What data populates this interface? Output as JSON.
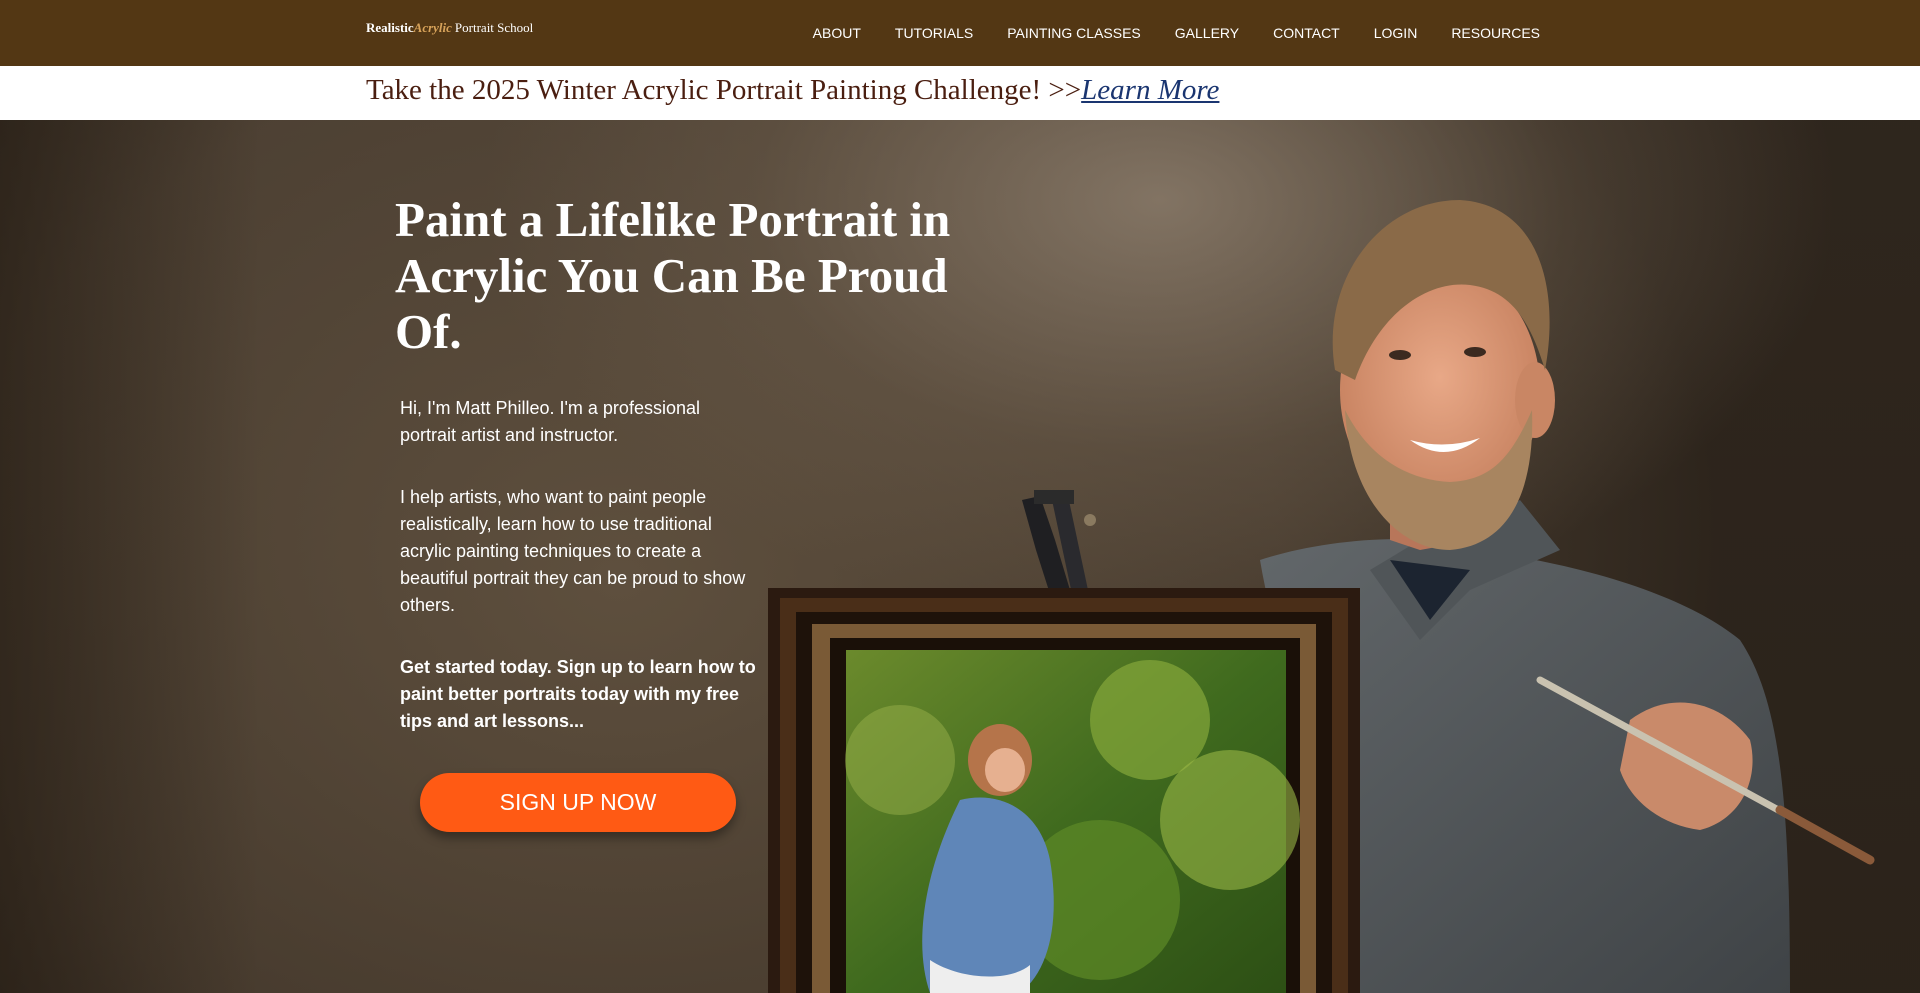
{
  "header": {
    "logo": {
      "part1": "Realistic",
      "part2": "Acrylic",
      "part3": "Portrait School"
    },
    "nav": [
      {
        "label": "ABOUT"
      },
      {
        "label": "TUTORIALS"
      },
      {
        "label": "PAINTING CLASSES"
      },
      {
        "label": "GALLERY"
      },
      {
        "label": "CONTACT"
      },
      {
        "label": "LOGIN"
      },
      {
        "label": "RESOURCES"
      }
    ]
  },
  "announcement": {
    "text": "Take the 2025 Winter Acrylic Portrait Painting Challenge! >>",
    "link": "Learn More"
  },
  "hero": {
    "title": "Paint a Lifelike Portrait in Acrylic You Can Be Proud Of.",
    "intro": "Hi, I'm Matt Philleo. I'm a professional portrait artist and instructor.",
    "body": "I help artists, who want to paint people realistically, learn how to use traditional acrylic painting techniques to create a beautiful portrait they can be proud to show others.",
    "cta_text": "Get started today. Sign up to learn how to paint better portraits today with my free tips and art lessons...",
    "button": "SIGN UP NOW"
  },
  "colors": {
    "header_bg": "#533714",
    "logo_accent": "#d8a35a",
    "announce_text": "#4a1e10",
    "announce_link": "#1a3570",
    "button_bg": "#ff5a14"
  }
}
